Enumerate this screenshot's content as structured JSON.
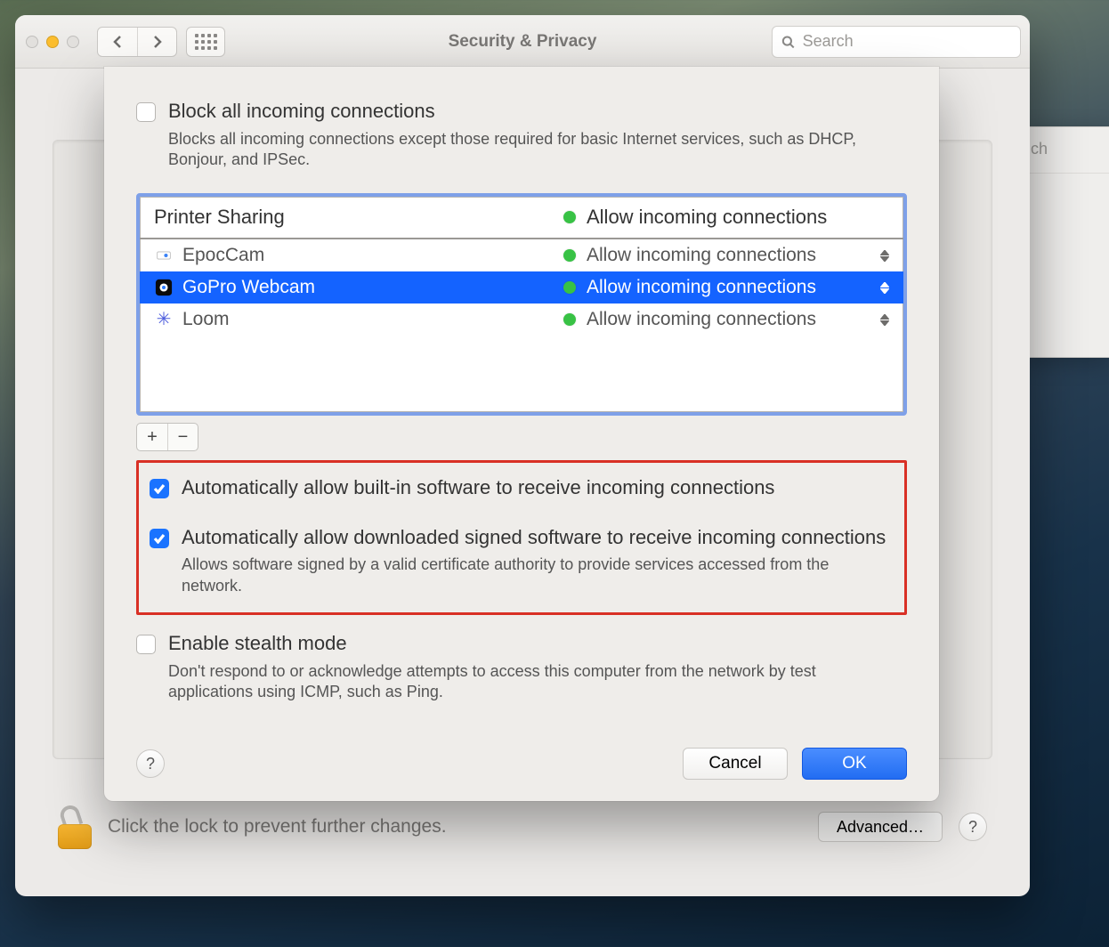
{
  "window": {
    "title": "Security & Privacy",
    "search_placeholder": "Search",
    "second_window_hint": "ch"
  },
  "sheet": {
    "block_all": {
      "label": "Block all incoming connections",
      "desc": "Blocks all incoming connections except those required for basic Internet services, such as DHCP, Bonjour, and IPSec.",
      "checked": false
    },
    "apps_header": {
      "left": "Printer Sharing",
      "right": "Allow incoming connections"
    },
    "apps": [
      {
        "name": "EpocCam",
        "status": "Allow incoming connections",
        "selected": false,
        "icon": "camera-dot-icon"
      },
      {
        "name": "GoPro Webcam",
        "status": "Allow incoming connections",
        "selected": true,
        "icon": "gopro-icon"
      },
      {
        "name": "Loom",
        "status": "Allow incoming connections",
        "selected": false,
        "icon": "asterisk-icon"
      }
    ],
    "addremove": {
      "add": "+",
      "remove": "−"
    },
    "auto_builtin": {
      "label": "Automatically allow built-in software to receive incoming connections",
      "checked": true
    },
    "auto_signed": {
      "label": "Automatically allow downloaded signed software to receive incoming connections",
      "desc": "Allows software signed by a valid certificate authority to provide services accessed from the network.",
      "checked": true
    },
    "stealth": {
      "label": "Enable stealth mode",
      "desc": "Don't respond to or acknowledge attempts to access this computer from the network by test applications using ICMP, such as Ping.",
      "checked": false
    },
    "buttons": {
      "cancel": "Cancel",
      "ok": "OK"
    }
  },
  "footer": {
    "lock_text": "Click the lock to prevent further changes.",
    "advanced": "Advanced…"
  }
}
